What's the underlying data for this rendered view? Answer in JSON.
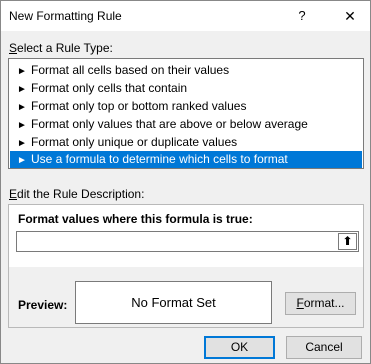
{
  "window": {
    "title": "New Formatting Rule",
    "help_label": "?",
    "close_label": "✕"
  },
  "rule_type": {
    "label": "Select a Rule Type:",
    "label_accel": "S",
    "label_rest": "elect a Rule Type:",
    "arrow": "►",
    "items": [
      "Format all cells based on their values",
      "Format only cells that contain",
      "Format only top or bottom ranked values",
      "Format only values that are above or below average",
      "Format only unique or duplicate values",
      "Use a formula to determine which cells to format"
    ],
    "selected_index": 5
  },
  "description": {
    "label": "Edit the Rule Description:",
    "label_accel": "E",
    "label_rest": "dit the Rule Description:",
    "formula_label": "Format values where this formula is true:",
    "formula_label_accel": "O",
    "formula_value": "",
    "collapse_icon": "⬆",
    "preview_label": "Preview:",
    "preview_text": "No Format Set",
    "format_button": "Format...",
    "format_button_accel": "F",
    "format_button_rest": "ormat..."
  },
  "buttons": {
    "ok": "OK",
    "cancel": "Cancel"
  },
  "colors": {
    "selection": "#0078d7",
    "dialog_bg": "#f0f0f0",
    "button_bg": "#e1e1e1"
  }
}
